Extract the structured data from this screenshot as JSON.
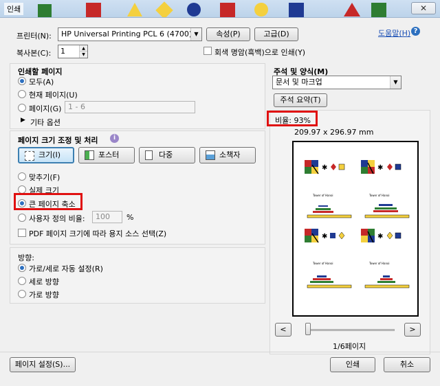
{
  "window": {
    "title": "인쇄",
    "close_glyph": "✕"
  },
  "printer": {
    "label": "프린터(N):",
    "value": "HP Universal Printing PCL 6 (4700)",
    "properties_button": "속성(P)",
    "advanced_button": "고급(D)",
    "help_link": "도움말(H)"
  },
  "copies": {
    "label": "복사본(C):",
    "value": "1",
    "grayscale_label": "회색 명암(흑백)으로 인쇄(Y)",
    "grayscale_checked": false
  },
  "pages_to_print": {
    "heading": "인쇄할 페이지",
    "options": [
      "모두(A)",
      "현재 페이지(U)",
      "페이지(G)"
    ],
    "selected": "모두(A)",
    "page_range_placeholder": "1 - 6",
    "more_options": "기타 옵션"
  },
  "page_sizing": {
    "heading": "페이지 크기 조정 및 처리",
    "info_glyph": "i",
    "tools": [
      "크기(I)",
      "포스터",
      "다중",
      "소책자"
    ],
    "selected_tool": "크기(I)",
    "options": [
      "맞추기(F)",
      "실제 크기",
      "큰 페이지 축소",
      "사용자 정의 비율:"
    ],
    "selected": "큰 페이지 축소",
    "custom_scale_value": "100",
    "percent": "%",
    "pdf_paper_source_label": "PDF 페이지 크기에 따라 용지 소스 선택(Z)",
    "pdf_paper_source_checked": false
  },
  "orientation": {
    "heading": "방향:",
    "options": [
      "가로/세로 자동 설정(R)",
      "세로 방향",
      "가로 방향"
    ],
    "selected": "가로/세로 자동 설정(R)"
  },
  "comments_forms": {
    "heading": "주석 및 양식(M)",
    "value": "문서 및 마크업",
    "summarize_button": "주석 요약(T)"
  },
  "preview": {
    "scale_text": "비율: 93%",
    "paper_size": "209.97 x 296.97 mm",
    "prev_glyph": "<",
    "next_glyph": ">",
    "page_status": "1/6페이지",
    "slider_fraction": 0,
    "thumbnail_caption": "Tower of Hanoi"
  },
  "footer": {
    "page_setup_button": "페이지 설정(S)...",
    "print_button": "인쇄",
    "cancel_button": "취소"
  },
  "colors": {
    "highlight_red": "#e01010",
    "selected_blue": "#3c7fb1",
    "link_blue": "#1a4fb5"
  }
}
